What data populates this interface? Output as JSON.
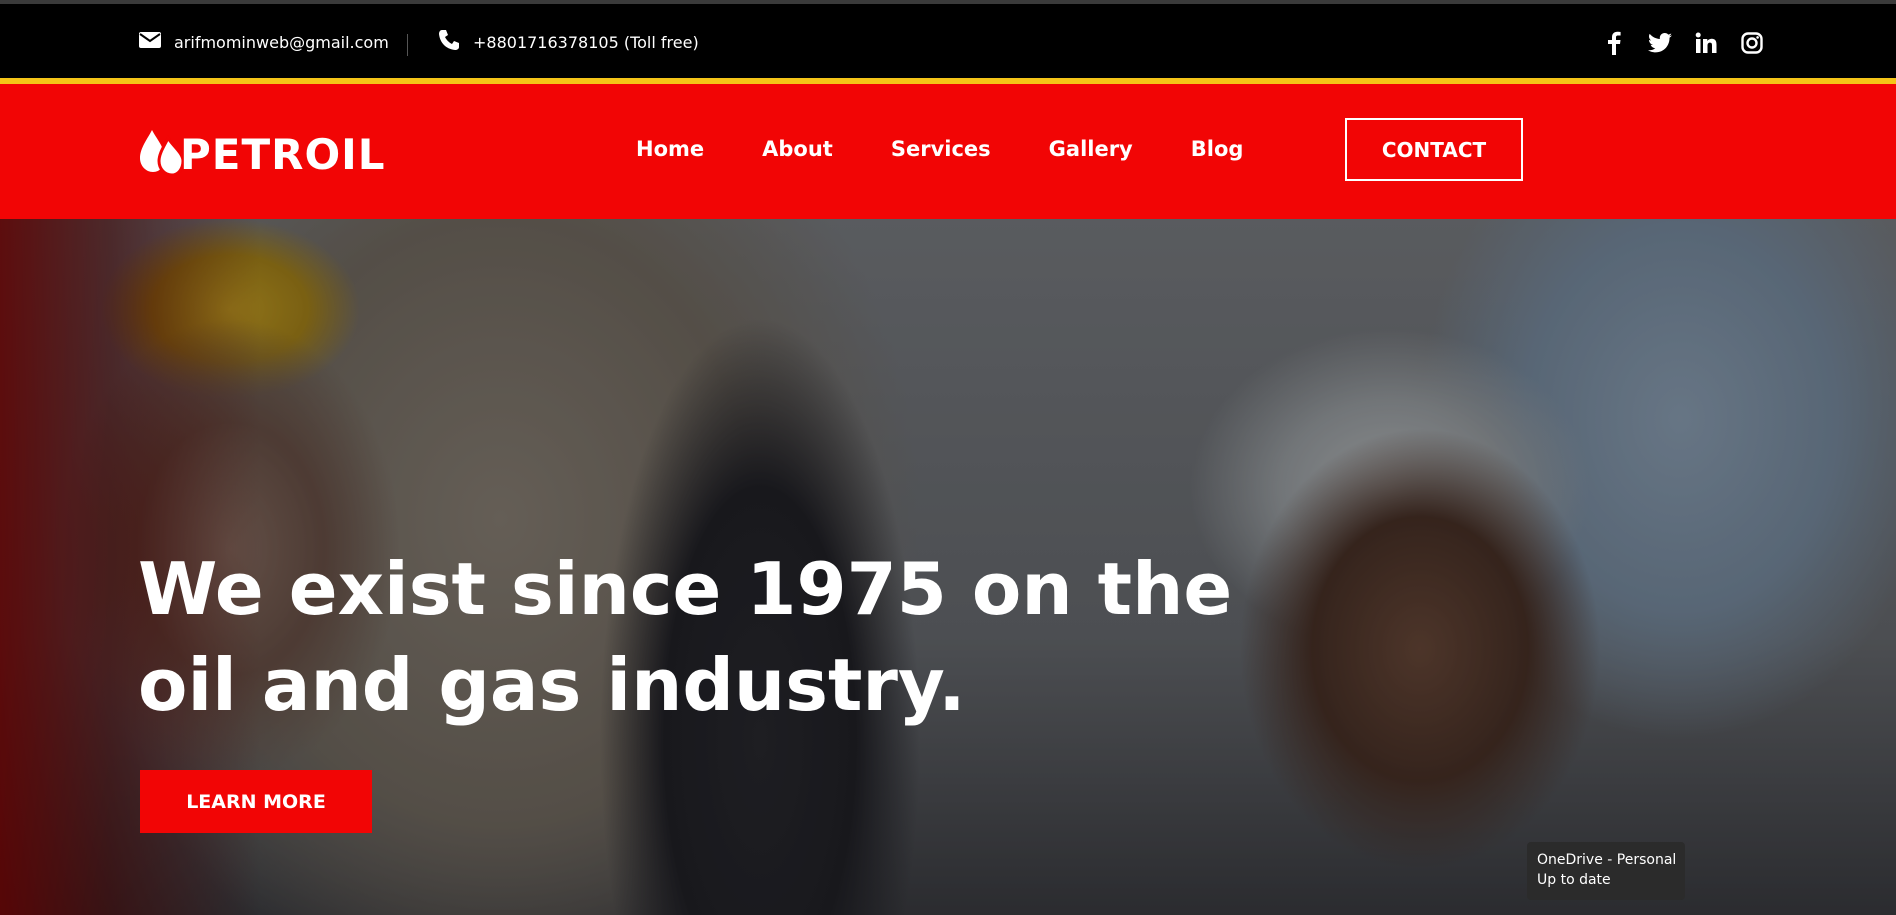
{
  "topbar": {
    "email": "arifmominweb@gmail.com",
    "phone": "+8801716378105 (Toll free)",
    "social": [
      "facebook-icon",
      "twitter-icon",
      "linkedin-icon",
      "instagram-icon"
    ]
  },
  "header": {
    "logo_text": "PETROIL",
    "nav": [
      {
        "label": "Home"
      },
      {
        "label": "About"
      },
      {
        "label": "Services"
      },
      {
        "label": "Gallery"
      },
      {
        "label": "Blog"
      }
    ],
    "contact_label": "CONTACT"
  },
  "hero": {
    "title_line1": "We exist since 1975 on the",
    "title_line2": "oil and gas industry.",
    "cta_label": "LEARN MORE"
  },
  "toast": {
    "line1": "OneDrive - Personal",
    "line2": "Up to date"
  },
  "colors": {
    "brand_red": "#f20505",
    "accent_yellow": "#f5c518",
    "topbar_bg": "#000000"
  }
}
